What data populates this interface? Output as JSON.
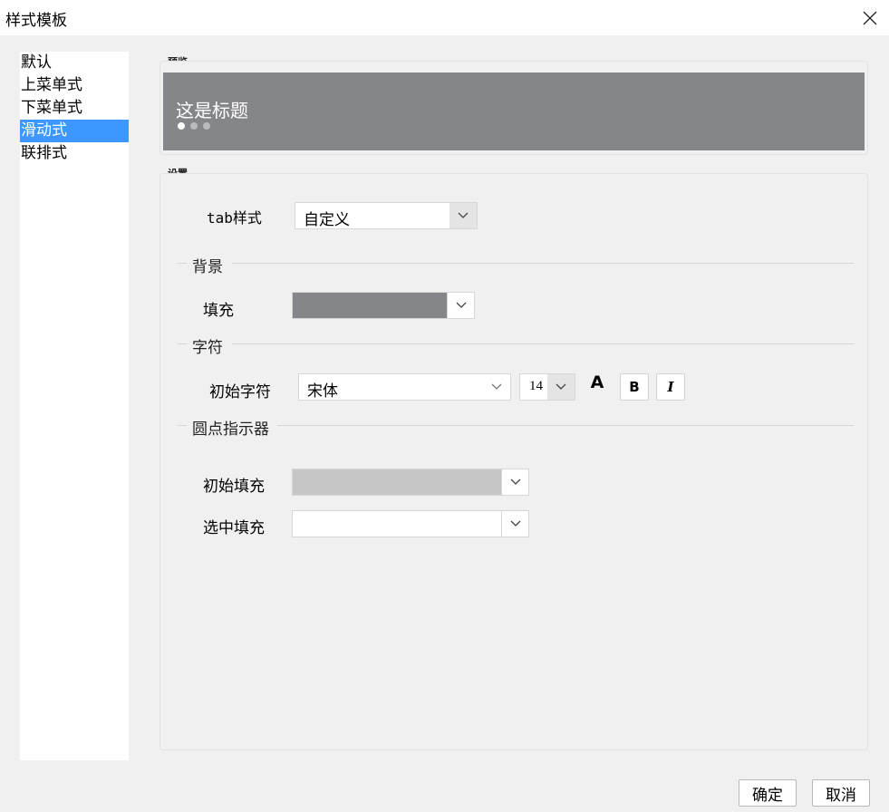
{
  "window": {
    "title": "样式模板"
  },
  "sidebar": {
    "items": [
      {
        "label": "默认"
      },
      {
        "label": "上菜单式"
      },
      {
        "label": "下菜单式"
      },
      {
        "label": "滑动式"
      },
      {
        "label": "联排式"
      }
    ],
    "selected_label": "滑动式"
  },
  "preview": {
    "caption": "预览",
    "banner_title": "这是标题",
    "banner_color": "#84868a",
    "dots_total": 3,
    "dot_active": 1
  },
  "settings": {
    "caption": "设置",
    "tab_style": {
      "label": "tab样式",
      "value": "自定义"
    },
    "background": {
      "section": "背景",
      "fill_label": "填充",
      "fill_color": "#84868a"
    },
    "font": {
      "section": "字符",
      "label": "初始字符",
      "family": "宋体",
      "size": "14",
      "color_button": "A",
      "bold_button": "B",
      "italic_button": "I"
    },
    "indicator": {
      "section": "圆点指示器",
      "initial_fill_label": "初始填充",
      "initial_fill_color": "#c6c6c6",
      "selected_fill_label": "选中填充",
      "selected_fill_color": "#ffffff"
    }
  },
  "footer": {
    "ok": "确定",
    "cancel": "取消"
  }
}
